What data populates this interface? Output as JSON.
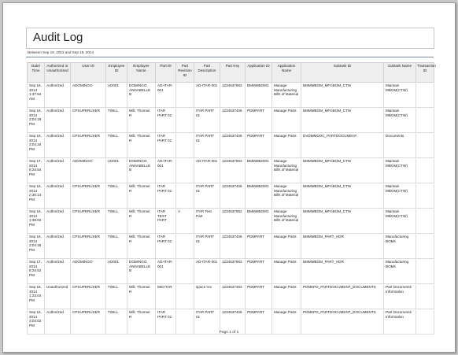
{
  "report": {
    "title": "Audit Log",
    "subtitle": "Between Sep 19, 2013 and Sep 19, 2014",
    "footer": "Page 1 of 1"
  },
  "columns": [
    "Date/ Time",
    "Authorized or Unauthorized",
    "User ID",
    "Employee ID",
    "Employee Name",
    "Part ID",
    "Part Revision ID",
    "Part Description",
    "Part Key",
    "Application ID",
    "Application Name",
    "Subtask ID",
    "Subtask Name",
    "Transaction ID"
  ],
  "rows": [
    [
      "Sep 16, 2014 1:37:54 AM",
      "Authorized",
      "ADOMINGO",
      "AD001",
      "DOMINGO, ANNABELLE B",
      "AD-ITAR-001",
      "",
      "AD-ITAR-001",
      "1234637963",
      "BMMMBOM1",
      "Manage Manufacturing Bills of Material",
      "BMMMBOM_MFGBOM_CTW",
      "Maintain MBOM(CTW)",
      ""
    ],
    [
      "Sep 16, 2014 3:04:19 PM",
      "Authorized",
      "CPSUPERUSER",
      "TWILL",
      "Will, Thomas R",
      "ITAR PART 01",
      "",
      "ITAR PART 01",
      "1234637406",
      "PDMPART",
      "Manage Parts",
      "BMMMBOM_MFGBOM_CTW",
      "Maintain MBOM(CTW)",
      ""
    ],
    [
      "Sep 16, 2014 3:04:34 PM",
      "Authorized",
      "CPSUPERUSER",
      "TWILL",
      "Will, Thomas R",
      "ITAR PART 01",
      "",
      "ITAR PART 01",
      "1234637406",
      "PDMPART",
      "Manage Parts",
      "DVDMMDOC_PARTDOCUMENT",
      "Documents",
      ""
    ],
    [
      "Sep 17, 2014 8:34:54 PM",
      "Authorized",
      "ADOMINGO",
      "AD001",
      "DOMINGO, ANNABELLE B",
      "AD-ITAR-001",
      "",
      "AD-ITAR-001",
      "1234637963",
      "BMMMBOM1",
      "Manage Manufacturing Bills of Material",
      "BMMMBOM_MFGBOM_CTW",
      "Maintain MBOM(CTW)",
      ""
    ],
    [
      "Sep 16, 2014 2:30:14 PM",
      "Authorized",
      "CPSUPERUSER",
      "TWILL",
      "Will, Thomas R",
      "ITAR PART 01",
      "",
      "ITAR PART 01",
      "1234637406",
      "BMMMBOM1",
      "Manage Manufacturing Bills of Material",
      "BMMMBOM_MFGBOM_CTW",
      "Maintain MBOM(CTW)",
      ""
    ],
    [
      "Sep 16, 2014 1:39:02 PM",
      "Authorized",
      "CPSUPERUSER",
      "TWILL",
      "Will, Thomas R",
      "ITAR TEST PART",
      "A",
      "ITAR Test Part",
      "1234637952",
      "BMMMBOM1",
      "Manage Manufacturing Bills of Material",
      "BMMMBOM_MFGBOM_CTW",
      "Maintain MBOM(CTW)",
      ""
    ],
    [
      "Sep 16, 2014 3:04:18 PM",
      "Authorized",
      "CPSUPERUSER",
      "TWILL",
      "Will, Thomas R",
      "ITAR PART 01",
      "",
      "ITAR PART 01",
      "1234637406",
      "PDMPART",
      "Manage Parts",
      "BMMMBOM_PART_HDR",
      "Manufacturing BOMs",
      ""
    ],
    [
      "Sep 17, 2014 8:34:52 PM",
      "Authorized",
      "ADOMINGO",
      "AD001",
      "DOMINGO, ANNABELLE B",
      "AD-ITAR-001",
      "",
      "AD-ITAR-001",
      "1234637963",
      "PDMPART",
      "Manage Parts",
      "BMMMBOM_PART_HDR",
      "Manufacturing BOMs",
      ""
    ],
    [
      "Sep 15, 2014 1:33:04 PM",
      "Unauthorized",
      "CPSUPERUSER",
      "TWILL",
      "Will, Thomas R",
      "MICITAR",
      "",
      "space rev",
      "1234637463",
      "PDMPART",
      "Manage Parts",
      "PDMEPD_PARTDOCUMENT_DOCUMENTS",
      "Part Documents Information",
      ""
    ],
    [
      "Sep 16, 2014 3:04:02 PM",
      "Authorized",
      "CPSUPERUSER",
      "TWILL",
      "Will, Thomas R",
      "ITAR PART 01",
      "",
      "ITAR PART 01",
      "1234637406",
      "PDMPART",
      "Manage Parts",
      "PDMEPD_PARTDOCUMENT_DOCUMENTS",
      "Part Documents Information",
      ""
    ]
  ]
}
